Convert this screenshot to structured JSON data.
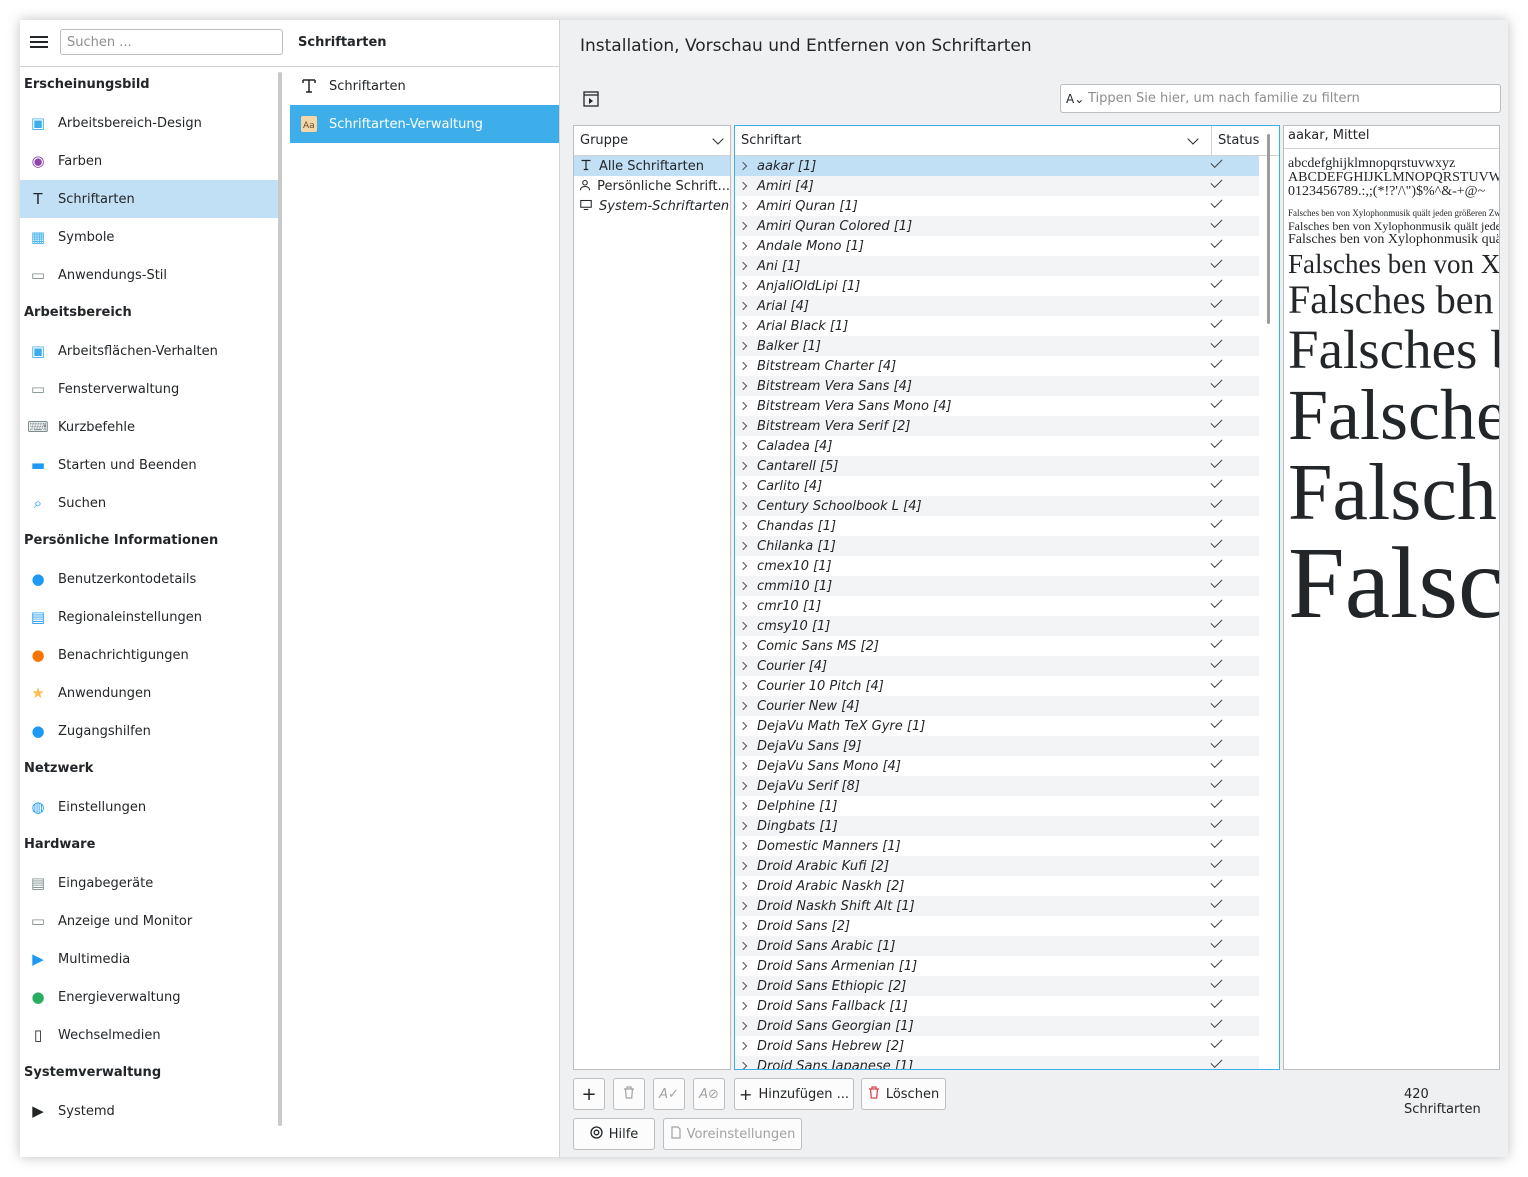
{
  "sidebar": {
    "search_placeholder": "Suchen ...",
    "categories": [
      {
        "label": "Erscheinungsbild",
        "items": [
          {
            "label": "Arbeitsbereich-Design",
            "icon": "landscape-icon",
            "color": "#3daee9"
          },
          {
            "label": "Farben",
            "icon": "color-wheel-icon",
            "color": "#8e44ad"
          },
          {
            "label": "Schriftarten",
            "icon": "font-icon",
            "color": "#232629",
            "active": true
          },
          {
            "label": "Symbole",
            "icon": "icons-grid-icon",
            "color": "#3daee9"
          },
          {
            "label": "Anwendungs-Stil",
            "icon": "window-style-icon",
            "color": "#7f8c8d"
          }
        ]
      },
      {
        "label": "Arbeitsbereich",
        "items": [
          {
            "label": "Arbeitsflächen-Verhalten",
            "icon": "desktop-behavior-icon",
            "color": "#3daee9"
          },
          {
            "label": "Fensterverwaltung",
            "icon": "window-icon",
            "color": "#7f8c8d"
          },
          {
            "label": "Kurzbefehle",
            "icon": "keyboard-icon",
            "color": "#7f8c8d"
          },
          {
            "label": "Starten und Beenden",
            "icon": "monitor-icon",
            "color": "#1d99f3"
          },
          {
            "label": "Suchen",
            "icon": "search-doc-icon",
            "color": "#1d99f3"
          }
        ]
      },
      {
        "label": "Persönliche Informationen",
        "items": [
          {
            "label": "Benutzerkontodetails",
            "icon": "user-icon",
            "color": "#1d99f3"
          },
          {
            "label": "Regionaleinstellungen",
            "icon": "chat-flag-icon",
            "color": "#1d99f3"
          },
          {
            "label": "Benachrichtigungen",
            "icon": "notification-icon",
            "color": "#f67400"
          },
          {
            "label": "Anwendungen",
            "icon": "star-icon",
            "color": "#fdbc4b"
          },
          {
            "label": "Zugangshilfen",
            "icon": "accessibility-icon",
            "color": "#1d99f3"
          }
        ]
      },
      {
        "label": "Netzwerk",
        "items": [
          {
            "label": "Einstellungen",
            "icon": "globe-icon",
            "color": "#1d99f3"
          }
        ]
      },
      {
        "label": "Hardware",
        "items": [
          {
            "label": "Eingabegeräte",
            "icon": "input-devices-icon",
            "color": "#7f8c8d"
          },
          {
            "label": "Anzeige und Monitor",
            "icon": "display-icon",
            "color": "#7f8c8d"
          },
          {
            "label": "Multimedia",
            "icon": "multimedia-icon",
            "color": "#1d99f3"
          },
          {
            "label": "Energieverwaltung",
            "icon": "battery-icon",
            "color": "#27ae60"
          },
          {
            "label": "Wechselmedien",
            "icon": "usb-icon",
            "color": "#232629"
          }
        ]
      },
      {
        "label": "Systemverwaltung",
        "items": [
          {
            "label": "Systemd",
            "icon": "systemd-icon",
            "color": "#232629"
          }
        ]
      }
    ]
  },
  "middle": {
    "title": "Schriftarten",
    "items": [
      {
        "label": "Schriftarten",
        "icon": "font-icon"
      },
      {
        "label": "Schriftarten-Verwaltung",
        "icon": "font-manager-icon",
        "selected": true
      }
    ]
  },
  "main": {
    "title": "Installation, Vorschau und Entfernen von Schriftarten",
    "filter_placeholder": "Tippen Sie hier, um nach familie zu filtern",
    "group_header": "Gruppe",
    "groups": [
      {
        "label": "Alle Schriftarten",
        "icon": "font-icon",
        "selected": true
      },
      {
        "label": "Persönliche Schrift...",
        "icon": "user-icon"
      },
      {
        "label": "System-Schriftarten",
        "icon": "computer-icon"
      }
    ],
    "font_header": "Schriftart",
    "status_header": "Status",
    "fonts": [
      "aakar [1]",
      "Amiri [4]",
      "Amiri Quran [1]",
      "Amiri Quran Colored [1]",
      "Andale Mono [1]",
      "Ani [1]",
      "AnjaliOldLipi [1]",
      "Arial [4]",
      "Arial Black [1]",
      "Balker [1]",
      "Bitstream Charter [4]",
      "Bitstream Vera Sans [4]",
      "Bitstream Vera Sans Mono [4]",
      "Bitstream Vera Serif [2]",
      "Caladea [4]",
      "Cantarell [5]",
      "Carlito [4]",
      "Century Schoolbook L [4]",
      "Chandas [1]",
      "Chilanka [1]",
      "cmex10 [1]",
      "cmmi10 [1]",
      "cmr10 [1]",
      "cmsy10 [1]",
      "Comic Sans MS [2]",
      "Courier [4]",
      "Courier 10 Pitch [4]",
      "Courier New [4]",
      "DejaVu Math TeX Gyre [1]",
      "DejaVu Sans [9]",
      "DejaVu Sans Mono [4]",
      "DejaVu Serif [8]",
      "Delphine [1]",
      "Dingbats [1]",
      "Domestic Manners [1]",
      "Droid Arabic Kufi [2]",
      "Droid Arabic Naskh [2]",
      "Droid Naskh Shift Alt [1]",
      "Droid Sans [2]",
      "Droid Sans Arabic [1]",
      "Droid Sans Armenian [1]",
      "Droid Sans Ethiopic [2]",
      "Droid Sans Fallback [1]",
      "Droid Sans Georgian [1]",
      "Droid Sans Hebrew [2]",
      "Droid Sans Japanese [1]"
    ],
    "preview": {
      "name": "aakar, Mittel",
      "lower": "abcdefghijklmnopqrstuvwxyz",
      "upper": "ABCDEFGHIJKLMNOPQRSTUVWXYZ",
      "digits": "0123456789.:,;(*!?'/\\\")$%^&-+@~",
      "sample": "Falsches  ben von Xylophonmusik quält jeden größeren Zwerg"
    },
    "buttons": {
      "add_label": "Hinzufügen ...",
      "delete_label": "Löschen",
      "help_label": "Hilfe",
      "defaults_label": "Voreinstellungen"
    },
    "count": "420 Schriftarten"
  }
}
